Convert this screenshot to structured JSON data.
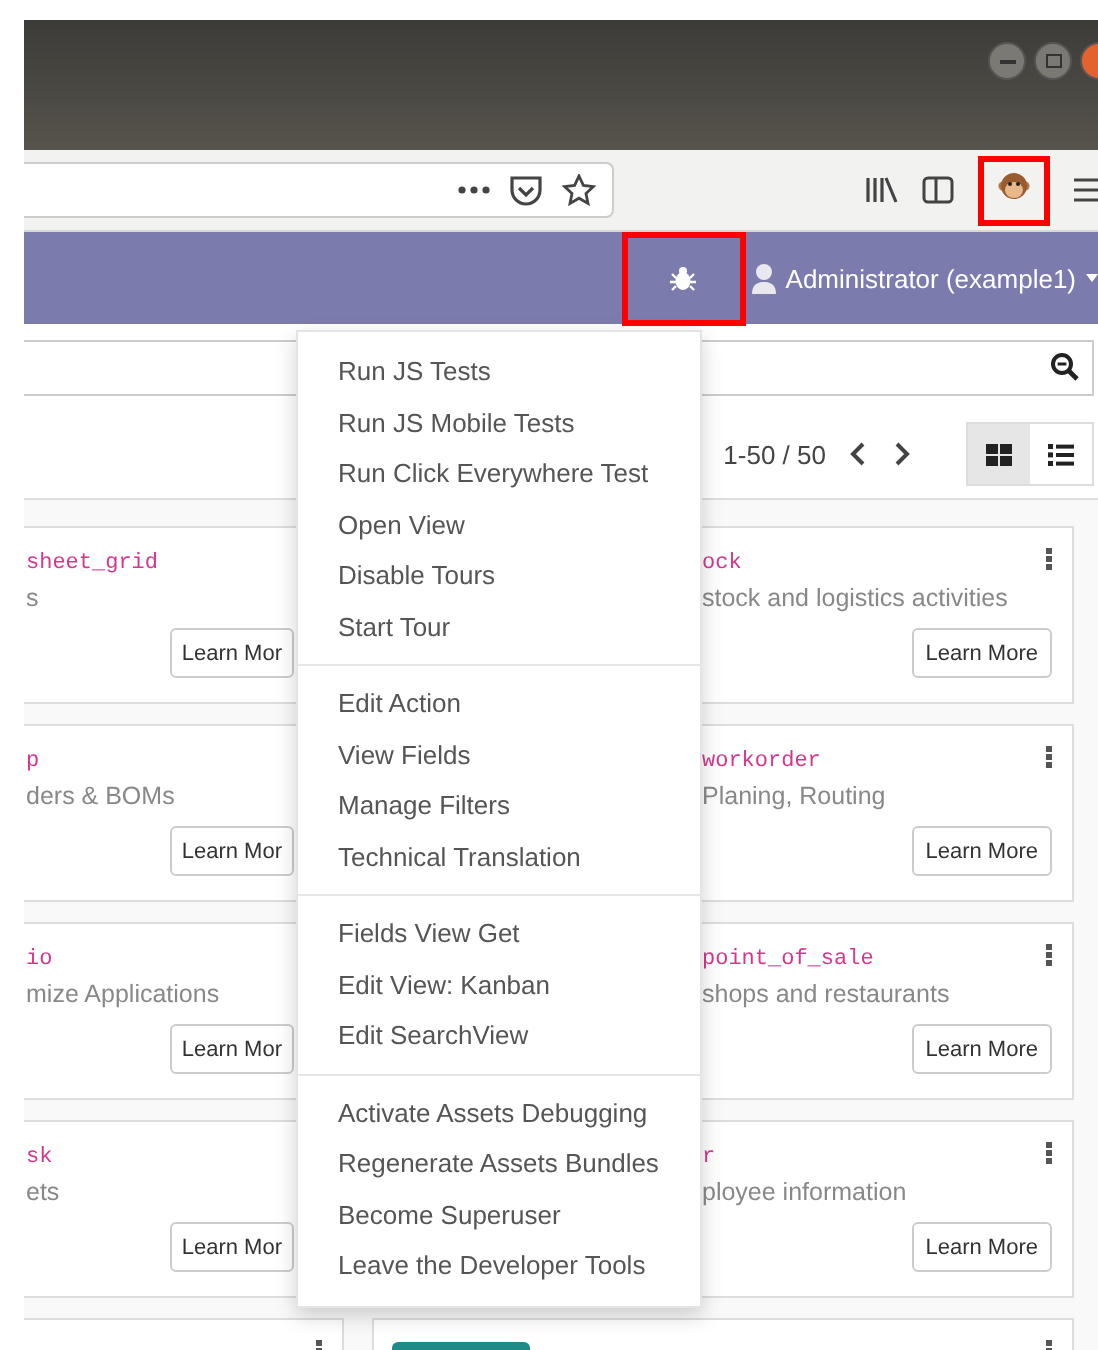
{
  "browser": {
    "extension": {
      "highlighted": true
    }
  },
  "navbar": {
    "debug": {
      "highlighted": true
    },
    "user": "Administrator (example1)"
  },
  "control_panel": {
    "pager": "1-50 / 50",
    "views": [
      {
        "kind": "kanban",
        "selected": true
      },
      {
        "kind": "list",
        "selected": false
      }
    ]
  },
  "cards": [
    {
      "left": {
        "name": "sheet_grid",
        "summary": "s",
        "button": "Learn Mor"
      },
      "right": {
        "name": "ock",
        "summary": "stock and logistics activities",
        "button": "Learn More"
      }
    },
    {
      "left": {
        "name": "p",
        "summary": "ders & BOMs",
        "button": "Learn Mor"
      },
      "right": {
        "name": "workorder",
        "summary": "Planing, Routing",
        "button": "Learn More"
      }
    },
    {
      "left": {
        "name": "io",
        "summary": "mize Applications",
        "button": "Learn Mor"
      },
      "right": {
        "name": "point_of_sale",
        "summary": "shops and restaurants",
        "button": "Learn More"
      }
    },
    {
      "left": {
        "name": "sk",
        "summary": "ets",
        "button": "Learn Mor"
      },
      "right": {
        "name": "r",
        "summary": "ployee information",
        "button": "Learn More"
      }
    }
  ],
  "debug_menu": [
    [
      "Run JS Tests",
      "Run JS Mobile Tests",
      "Run Click Everywhere Test",
      "Open View",
      "Disable Tours",
      "Start Tour"
    ],
    [
      "Edit Action",
      "View Fields",
      "Manage Filters",
      "Technical Translation"
    ],
    [
      "Fields View Get",
      "Edit View: Kanban",
      "Edit SearchView"
    ],
    [
      "Activate Assets Debugging",
      "Regenerate Assets Bundles",
      "Become Superuser",
      "Leave the Developer Tools"
    ]
  ]
}
